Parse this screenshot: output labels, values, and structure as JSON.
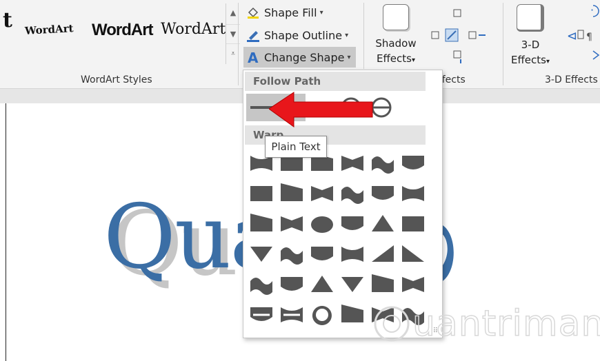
{
  "ribbon": {
    "wordart_styles": {
      "samples": [
        "t",
        "WordArt",
        "WordArt",
        "WordArt"
      ],
      "label": "WordArt Styles"
    },
    "commands": {
      "shape_fill": "Shape Fill",
      "shape_outline": "Shape Outline",
      "change_shape": "Change Shape"
    },
    "shadow_effects": {
      "line1": "Shadow",
      "line2": "Effects"
    },
    "shadow_group_label_fragment": "ffects",
    "three_d": {
      "line1": "3-D",
      "line2": "Effects",
      "group_label": "3-D Effects"
    },
    "caret": "▾"
  },
  "document": {
    "wordart_text": "Quan"
  },
  "dropdown": {
    "follow_path_header": "Follow Path",
    "warp_header": "Warp",
    "selected_item": "Plain Text",
    "tooltip": "Plain Text",
    "annotation_arrow_color": "#e8161b",
    "shape_color": "#555555",
    "follow_path_items": [
      "plain-text",
      "arch-up",
      "arch-down",
      "circle",
      "button"
    ],
    "warp_rows": [
      [
        "triangle-up",
        "triangle-down",
        "chevron-up",
        "chevron-down",
        "ring-inside",
        "ring-outside"
      ],
      [
        "arch-up-curve",
        "arch-down-curve",
        "circle-curve",
        "button-curve",
        "can-up",
        "can-down"
      ],
      [
        "wave1",
        "wave2",
        "double-wave1",
        "double-wave2",
        "inflate",
        "deflate"
      ],
      [
        "inflate-bottom",
        "deflate-bottom",
        "inflate-top",
        "deflate-top",
        "deflate-inflate",
        "deflate-inflate-deflate"
      ],
      [
        "fade-right",
        "fade-left",
        "fade-up",
        "fade-down",
        "slant-up",
        "slant-down"
      ],
      [
        "cascade-up",
        "cascade-down",
        "circle-warp",
        "arch-warp",
        "chevron",
        "chevron-inv"
      ]
    ]
  },
  "watermark": {
    "text": "uantrimang"
  }
}
